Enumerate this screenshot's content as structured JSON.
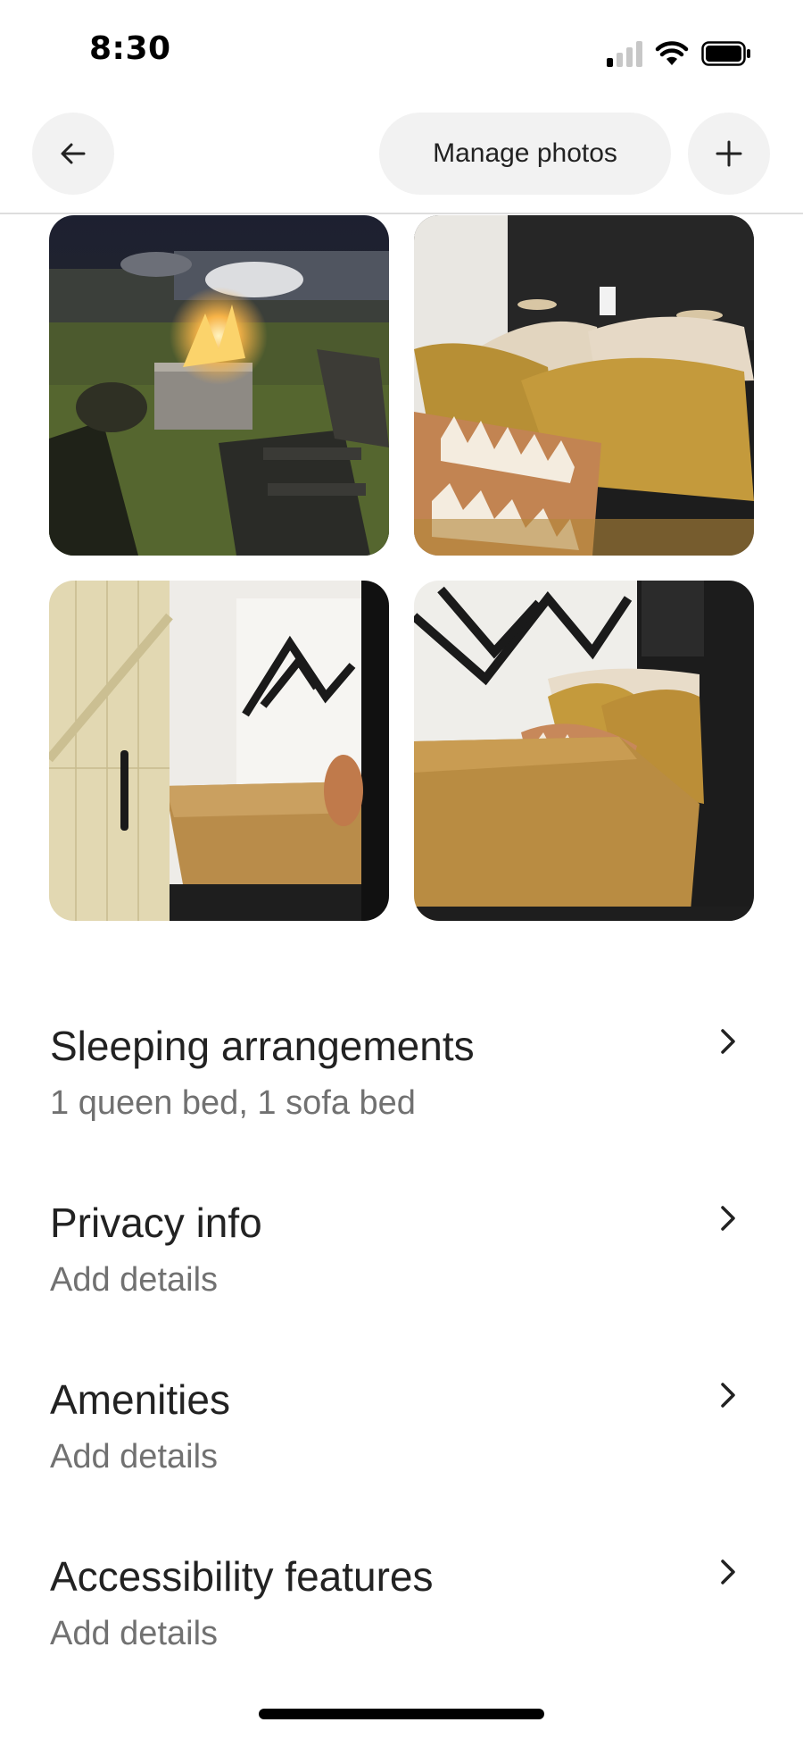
{
  "status_bar": {
    "time": "8:30"
  },
  "nav": {
    "back_icon": "arrow-left-icon",
    "manage_label": "Manage photos",
    "add_icon": "plus-icon"
  },
  "photos": [
    {
      "subject": "fire pit at night with adirondack chairs"
    },
    {
      "subject": "bed with mustard pillows and patterned cushion"
    },
    {
      "subject": "bedroom seen through sliding barn door"
    },
    {
      "subject": "bed with mountain wall art"
    }
  ],
  "details": [
    {
      "title": "Sleeping arrangements",
      "subtitle": "1 queen bed, 1 sofa bed"
    },
    {
      "title": "Privacy info",
      "subtitle": "Add details"
    },
    {
      "title": "Amenities",
      "subtitle": "Add details"
    },
    {
      "title": "Accessibility features",
      "subtitle": "Add details"
    }
  ],
  "colors": {
    "text_primary": "#222222",
    "text_secondary": "#717171",
    "button_bg": "#f2f2f2",
    "divider": "#dddddd"
  }
}
